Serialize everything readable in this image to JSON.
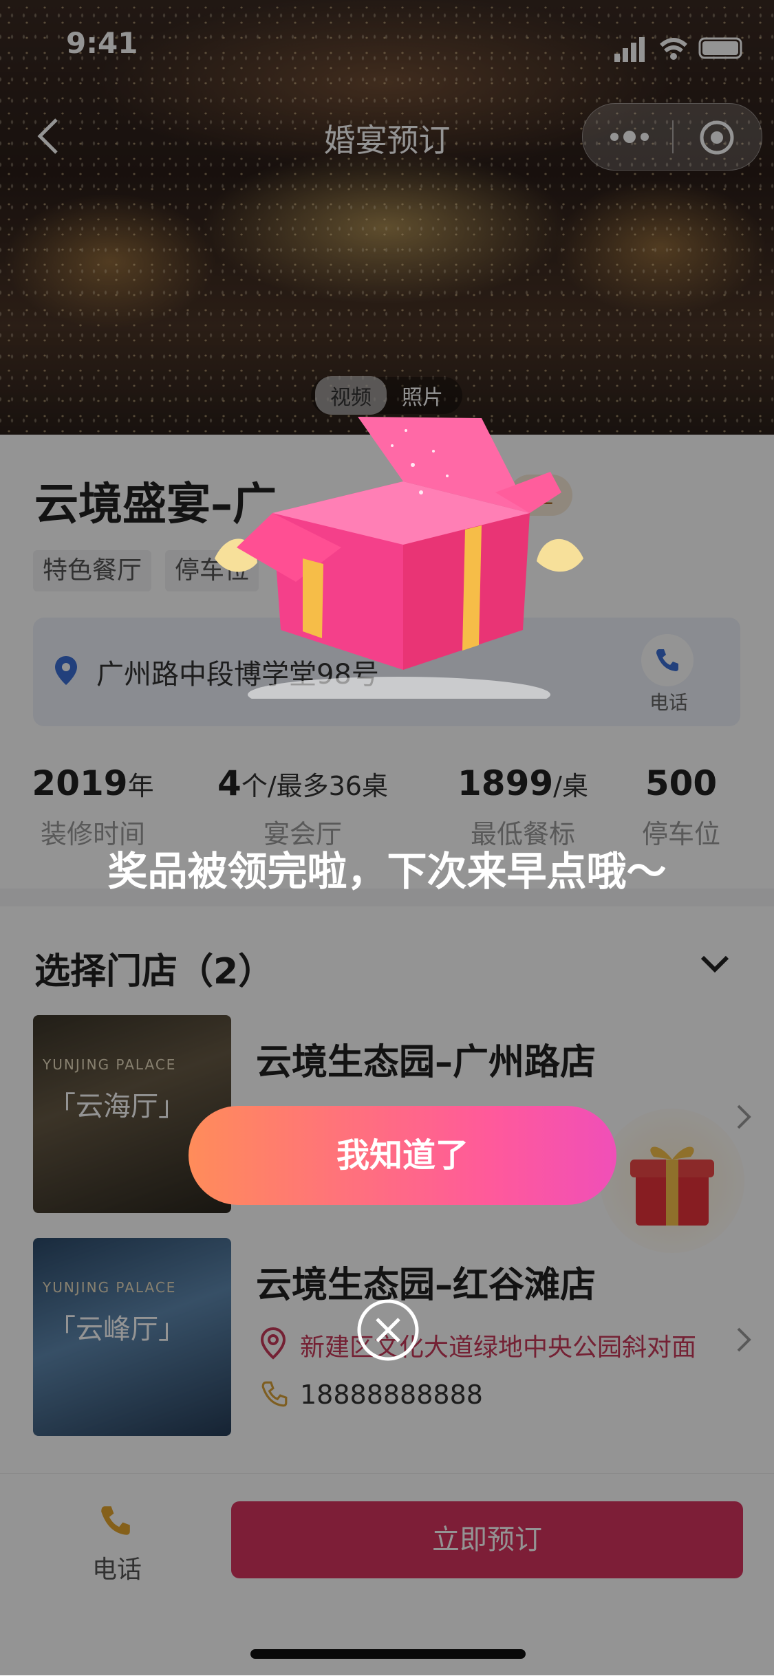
{
  "status_bar": {
    "time": "9:41"
  },
  "nav": {
    "title": "婚宴预订"
  },
  "media": {
    "tabs": [
      "视频",
      "照片"
    ],
    "active": 0
  },
  "venue": {
    "title": "云境盛宴–广",
    "cert_badge": "证",
    "tags": [
      "特色餐厅",
      "停车位"
    ],
    "address": "广州路中段博学堂98号",
    "phone_label": "电话"
  },
  "stats": [
    {
      "value": "2019",
      "unit": "年",
      "label": "装修时间"
    },
    {
      "value": "4",
      "unit": "个/最多36桌",
      "label": "宴会厅"
    },
    {
      "value": "1899",
      "unit": "/桌",
      "label": "最低餐标"
    },
    {
      "value": "500",
      "unit": "",
      "label": "停车位"
    }
  ],
  "stores_section": {
    "title": "选择门店（2）"
  },
  "stores": [
    {
      "name": "云境生态园–广州路店",
      "image_caption": "「云海厅」",
      "image_sub": "YUNJING PALACE"
    },
    {
      "name": "云境生态园–红谷滩店",
      "address": "新建区文化大道绿地中央公园斜对面",
      "phone": "18888888888",
      "image_caption": "「云峰厅」",
      "image_sub": "YUNJING PALACE"
    }
  ],
  "bottom_bar": {
    "phone_label": "电话",
    "book_label": "立即预订"
  },
  "modal": {
    "message": "奖品被领完啦，下次来早点哦～",
    "confirm_label": "我知道了"
  },
  "colors": {
    "accent": "#d8345f",
    "modal_gradient_start": "#ff8c5a",
    "modal_gradient_end": "#f04fb8"
  }
}
